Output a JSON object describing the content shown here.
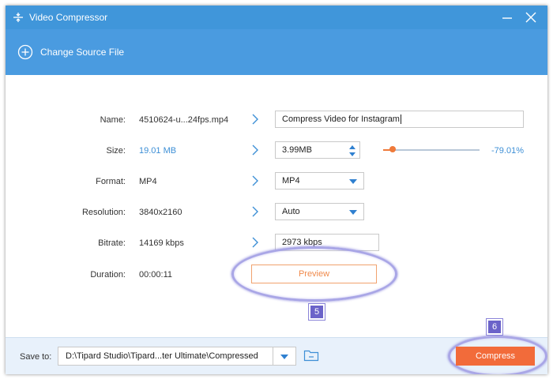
{
  "window": {
    "title": "Video Compressor"
  },
  "toolbar": {
    "change_source_label": "Change Source File"
  },
  "form": {
    "name": {
      "label": "Name:",
      "source": "4510624-u...24fps.mp4",
      "value": "Compress Video for Instagram"
    },
    "size": {
      "label": "Size:",
      "source": "19.01 MB",
      "value": "3.99MB",
      "percent_text": "-79.01%",
      "slider_fraction": 0.1
    },
    "format": {
      "label": "Format:",
      "source": "MP4",
      "value": "MP4"
    },
    "resolution": {
      "label": "Resolution:",
      "source": "3840x2160",
      "value": "Auto"
    },
    "bitrate": {
      "label": "Bitrate:",
      "source": "14169 kbps",
      "value": "2973 kbps"
    },
    "duration": {
      "label": "Duration:",
      "source": "00:00:11"
    }
  },
  "preview_label": "Preview",
  "callouts": {
    "preview_step": "5",
    "compress_step": "6"
  },
  "footer": {
    "save_to_label": "Save to:",
    "save_path": "D:\\Tipard Studio\\Tipard...ter Ultimate\\Compressed",
    "compress_label": "Compress"
  },
  "colors": {
    "titlebar": "#4096da",
    "toolbar": "#4a9be0",
    "accent_orange": "#f26b3a",
    "source_size_blue": "#3d8fd6",
    "callout_purple": "#6b63c9"
  },
  "icons": {
    "app": "compress-arrows-icon",
    "minimize": "minimize-icon",
    "close": "close-icon",
    "add": "plus-circle-icon",
    "chevron": "chevron-right-icon",
    "dropdown": "caret-down-icon",
    "folder": "folder-icon"
  }
}
